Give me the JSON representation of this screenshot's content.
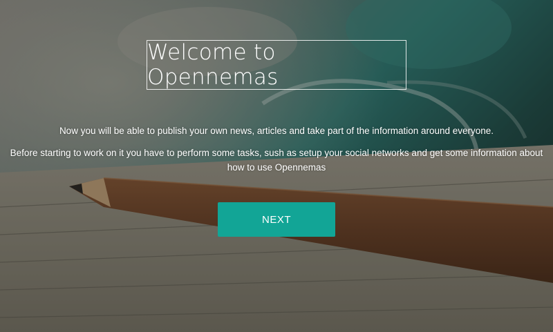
{
  "welcome": {
    "title": "Welcome to Opennemas",
    "intro": "Now you will be able to publish your own news, articles and take part of the information around everyone.",
    "instructions": "Before starting to work on it you have to perform some tasks, sush as setup your social networks and get some information about how to use Opennemas",
    "next_label": "NEXT"
  },
  "colors": {
    "accent": "#12a596",
    "text": "#ffffff"
  }
}
